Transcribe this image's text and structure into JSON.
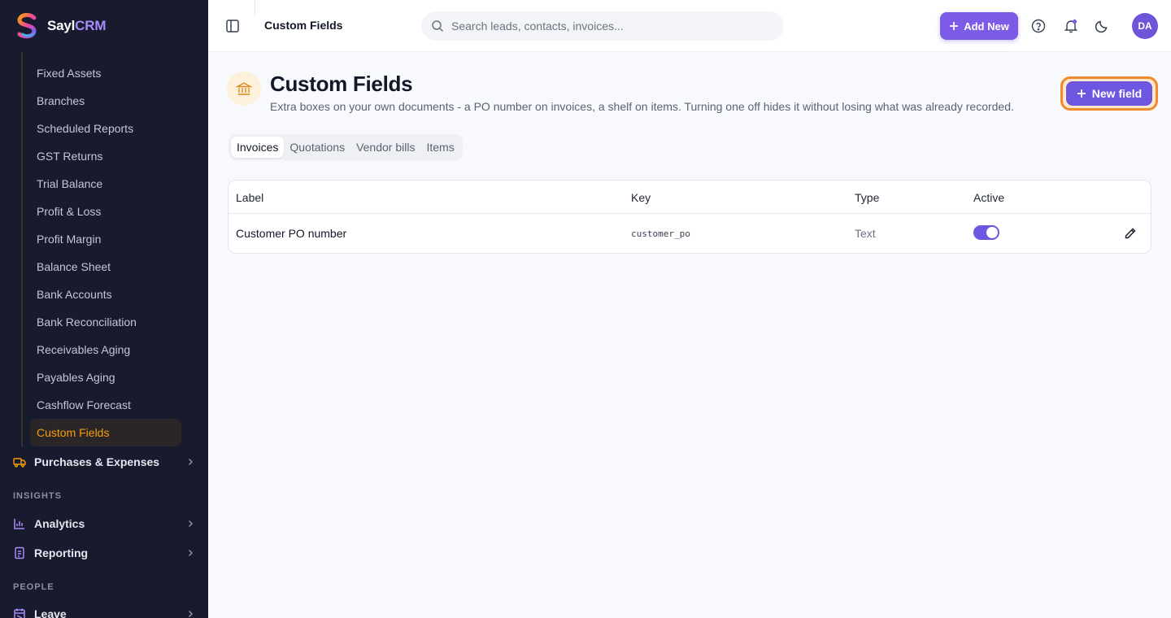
{
  "brand": {
    "name_part1": "Sayl",
    "name_part2": "CRM"
  },
  "sidebar": {
    "sub_items": [
      {
        "label": "Fixed Assets",
        "active": false
      },
      {
        "label": "Branches",
        "active": false
      },
      {
        "label": "Scheduled Reports",
        "active": false
      },
      {
        "label": "GST Returns",
        "active": false
      },
      {
        "label": "Trial Balance",
        "active": false
      },
      {
        "label": "Profit & Loss",
        "active": false
      },
      {
        "label": "Profit Margin",
        "active": false
      },
      {
        "label": "Balance Sheet",
        "active": false
      },
      {
        "label": "Bank Accounts",
        "active": false
      },
      {
        "label": "Bank Reconciliation",
        "active": false
      },
      {
        "label": "Receivables Aging",
        "active": false
      },
      {
        "label": "Payables Aging",
        "active": false
      },
      {
        "label": "Cashflow Forecast",
        "active": false
      },
      {
        "label": "Custom Fields",
        "active": true
      }
    ],
    "purchases": {
      "label": "Purchases & Expenses",
      "icon": "truck-icon"
    },
    "insights_label": "INSIGHTS",
    "analytics": {
      "label": "Analytics",
      "icon": "bar-chart-icon"
    },
    "reporting": {
      "label": "Reporting",
      "icon": "report-icon"
    },
    "people_label": "PEOPLE",
    "leave": {
      "label": "Leave",
      "icon": "calendar-icon"
    }
  },
  "topbar": {
    "breadcrumb": "Custom Fields",
    "search_placeholder": "Search leads, contacts, invoices...",
    "add_new_label": "Add New",
    "avatar_initials": "DA"
  },
  "page": {
    "title": "Custom Fields",
    "subtitle": "Extra boxes on your own documents - a PO number on invoices, a shelf on items. Turning one off hides it without losing what was already recorded.",
    "new_field_label": "New field",
    "tabs": [
      {
        "label": "Invoices",
        "active": true
      },
      {
        "label": "Quotations",
        "active": false
      },
      {
        "label": "Vendor bills",
        "active": false
      },
      {
        "label": "Items",
        "active": false
      }
    ]
  },
  "table": {
    "headers": {
      "label": "Label",
      "key": "Key",
      "type": "Type",
      "active": "Active"
    },
    "rows": [
      {
        "label": "Customer PO number",
        "key": "customer_po",
        "type": "Text",
        "active": true
      }
    ]
  },
  "colors": {
    "sidebar_bg": "#181a2e",
    "accent_purple": "#6e56e0",
    "active_orange": "#f59e0b",
    "highlight_ring": "#f08a2c"
  }
}
